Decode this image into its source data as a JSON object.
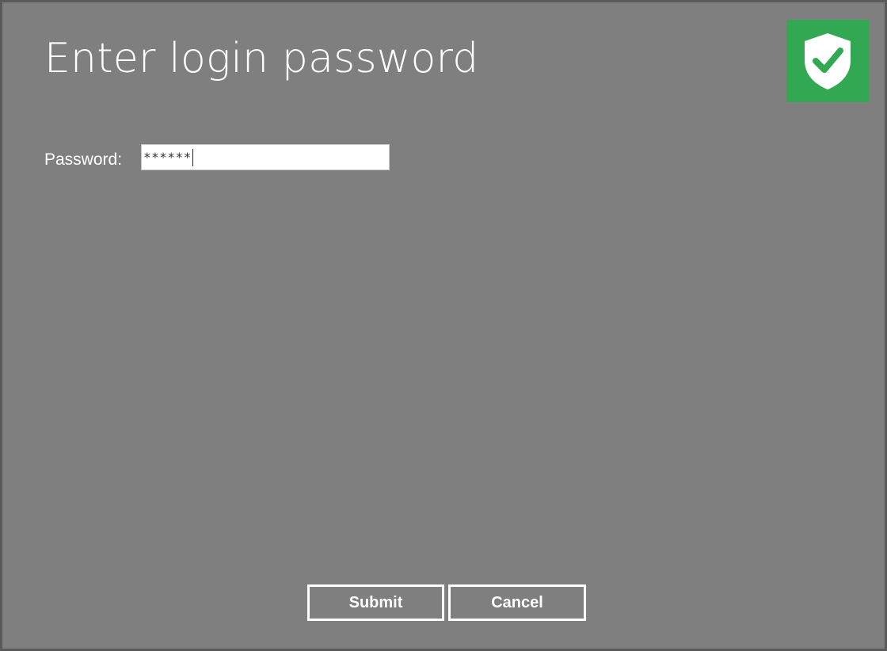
{
  "dialog": {
    "title": "Enter login password",
    "badge_icon": "shield-check-icon",
    "badge_color": "#32a852",
    "background_color": "#7f7f7f"
  },
  "form": {
    "password_label": "Password:",
    "password_value": "******"
  },
  "buttons": {
    "submit_label": "Submit",
    "cancel_label": "Cancel"
  }
}
